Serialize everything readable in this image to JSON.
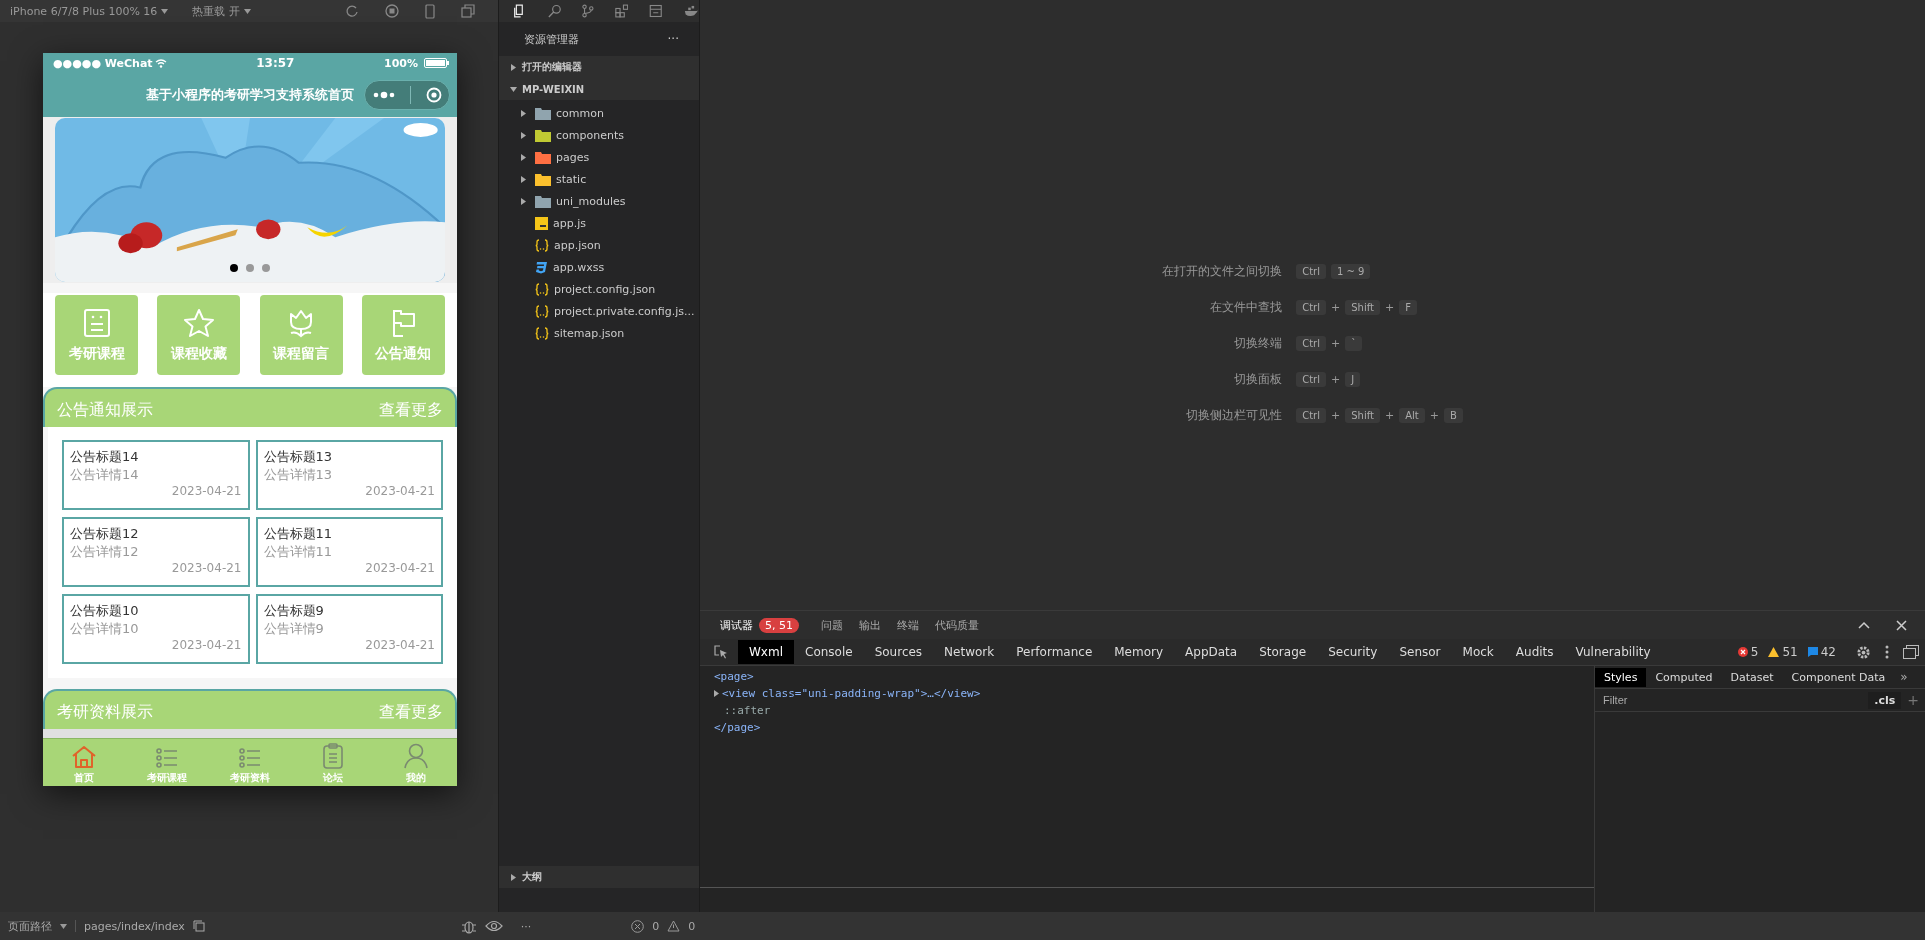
{
  "simulator": {
    "device_label": "iPhone 6/7/8 Plus 100% 16",
    "hot_reload_label": "热重载 开",
    "phone": {
      "status_bar": {
        "carrier": "●●●●● WeChat",
        "time": "13:57",
        "battery": "100%"
      },
      "nav_title": "基于小程序的考研学习支持系统首页",
      "banner": {
        "dots": [
          {
            "selected": true
          },
          {
            "selected": false
          },
          {
            "selected": false
          }
        ]
      },
      "grid": [
        {
          "label": "考研课程"
        },
        {
          "label": "课程收藏"
        },
        {
          "label": "课程留言"
        },
        {
          "label": "公告通知"
        }
      ],
      "notice_section": {
        "title": "公告通知展示",
        "more": "查看更多",
        "cards": [
          {
            "title": "公告标题14",
            "detail": "公告详情14",
            "date": "2023-04-21"
          },
          {
            "title": "公告标题13",
            "detail": "公告详情13",
            "date": "2023-04-21"
          },
          {
            "title": "公告标题12",
            "detail": "公告详情12",
            "date": "2023-04-21"
          },
          {
            "title": "公告标题11",
            "detail": "公告详情11",
            "date": "2023-04-21"
          },
          {
            "title": "公告标题10",
            "detail": "公告详情10",
            "date": "2023-04-21"
          },
          {
            "title": "公告标题9",
            "detail": "公告详情9",
            "date": "2023-04-21"
          }
        ]
      },
      "material_section": {
        "title": "考研资料展示",
        "more": "查看更多"
      },
      "tab_bar": [
        {
          "label": "首页",
          "selected": true
        },
        {
          "label": "考研课程",
          "selected": false
        },
        {
          "label": "考研资料",
          "selected": false
        },
        {
          "label": "论坛",
          "selected": false
        },
        {
          "label": "我的",
          "selected": false
        }
      ]
    }
  },
  "explorer": {
    "title": "资源管理器",
    "more": "···",
    "sections": [
      {
        "label": "打开的编辑器",
        "expanded": false
      },
      {
        "label": "MP-WEIXIN",
        "expanded": true
      }
    ],
    "files": [
      {
        "name": "common",
        "kind": "folder",
        "color": "#90a4ae"
      },
      {
        "name": "components",
        "kind": "folder",
        "color": "#c0ca33"
      },
      {
        "name": "pages",
        "kind": "folder",
        "color": "#ff7043"
      },
      {
        "name": "static",
        "kind": "folder",
        "color": "#fbc02d"
      },
      {
        "name": "uni_modules",
        "kind": "folder",
        "color": "#90a4ae"
      },
      {
        "name": "app.js",
        "kind": "js"
      },
      {
        "name": "app.json",
        "kind": "json"
      },
      {
        "name": "app.wxss",
        "kind": "css"
      },
      {
        "name": "project.config.json",
        "kind": "json"
      },
      {
        "name": "project.private.config.js...",
        "kind": "json"
      },
      {
        "name": "sitemap.json",
        "kind": "json"
      }
    ],
    "outline": {
      "label": "大纲",
      "expanded": false
    }
  },
  "shortcuts": [
    {
      "label": "在打开的文件之间切换",
      "keys": [
        {
          "kind": "key",
          "text": "Ctrl"
        },
        {
          "kind": "key",
          "text": "1 ~ 9"
        }
      ]
    },
    {
      "label": "在文件中查找",
      "keys": [
        {
          "kind": "key",
          "text": "Ctrl"
        },
        {
          "kind": "plus",
          "text": "+"
        },
        {
          "kind": "key",
          "text": "Shift"
        },
        {
          "kind": "plus",
          "text": "+"
        },
        {
          "kind": "key",
          "text": "F"
        }
      ]
    },
    {
      "label": "切换终端",
      "keys": [
        {
          "kind": "key",
          "text": "Ctrl"
        },
        {
          "kind": "plus",
          "text": "+"
        },
        {
          "kind": "key",
          "text": "`"
        }
      ]
    },
    {
      "label": "切换面板",
      "keys": [
        {
          "kind": "key",
          "text": "Ctrl"
        },
        {
          "kind": "plus",
          "text": "+"
        },
        {
          "kind": "key",
          "text": "J"
        }
      ]
    },
    {
      "label": "切换侧边栏可见性",
      "keys": [
        {
          "kind": "key",
          "text": "Ctrl"
        },
        {
          "kind": "plus",
          "text": "+"
        },
        {
          "kind": "key",
          "text": "Shift"
        },
        {
          "kind": "plus",
          "text": "+"
        },
        {
          "kind": "key",
          "text": "Alt"
        },
        {
          "kind": "plus",
          "text": "+"
        },
        {
          "kind": "key",
          "text": "B"
        }
      ]
    }
  ],
  "devtools": {
    "panel_tabs": [
      {
        "label": "调试器",
        "selected": true,
        "badge": "5, 51"
      },
      {
        "label": "问题",
        "selected": false
      },
      {
        "label": "输出",
        "selected": false
      },
      {
        "label": "终端",
        "selected": false
      },
      {
        "label": "代码质量",
        "selected": false
      }
    ],
    "tool_tabs": [
      {
        "label": "Wxml",
        "selected": true
      },
      {
        "label": "Console",
        "selected": false
      },
      {
        "label": "Sources",
        "selected": false
      },
      {
        "label": "Network",
        "selected": false
      },
      {
        "label": "Performance",
        "selected": false
      },
      {
        "label": "Memory",
        "selected": false
      },
      {
        "label": "AppData",
        "selected": false
      },
      {
        "label": "Storage",
        "selected": false
      },
      {
        "label": "Security",
        "selected": false
      },
      {
        "label": "Sensor",
        "selected": false
      },
      {
        "label": "Mock",
        "selected": false
      },
      {
        "label": "Audits",
        "selected": false
      },
      {
        "label": "Vulnerability",
        "selected": false
      }
    ],
    "counts": {
      "errors": "5",
      "warnings": "51",
      "infos": "42"
    },
    "code_lines": [
      {
        "kind": "tag",
        "text": "<page>",
        "expandable": false
      },
      {
        "kind": "tag",
        "text": "<view class=\"uni-padding-wrap\">…</view>",
        "expandable": true
      },
      {
        "kind": "pseudo",
        "text": "::after",
        "expandable": false
      },
      {
        "kind": "tag",
        "text": "</page>",
        "expandable": false
      }
    ],
    "styles_tabs": [
      {
        "label": "Styles",
        "selected": true
      },
      {
        "label": "Computed",
        "selected": false
      },
      {
        "label": "Dataset",
        "selected": false
      },
      {
        "label": "Component Data",
        "selected": false
      }
    ],
    "more_tabs": "»",
    "filter_placeholder": "Filter",
    "cls": ".cls",
    "add": "+"
  },
  "status_bar": {
    "path_label": "页面路径",
    "path": "pages/index/index",
    "errors": "0",
    "warnings": "0",
    "more": "···"
  }
}
